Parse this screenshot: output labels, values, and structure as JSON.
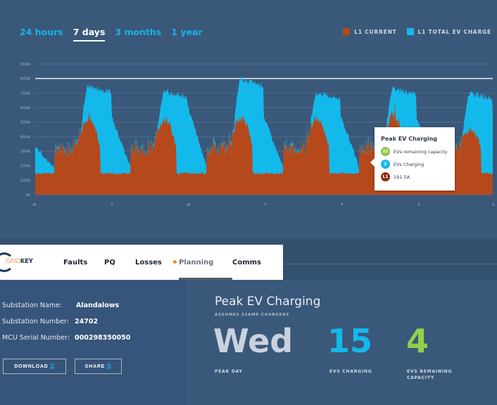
{
  "range_tabs": [
    {
      "label": "24 hours",
      "active": false
    },
    {
      "label": "7 days",
      "active": true
    },
    {
      "label": "3 months",
      "active": false
    },
    {
      "label": "1 year",
      "active": false
    }
  ],
  "legend": [
    {
      "label": "L1 CURRENT",
      "color": "#b5491c"
    },
    {
      "label": "L1 TOTAL EV CHARGE",
      "color": "#14b9ec"
    }
  ],
  "chart_data": {
    "type": "area",
    "title": "",
    "xlabel": "",
    "ylabel": "",
    "x_ticks": [
      "M",
      "T",
      "W",
      "T",
      "F",
      "S",
      "S"
    ],
    "y_ticks": [
      "0A",
      "100A",
      "200A",
      "300A",
      "400A",
      "500A",
      "600A",
      "700A",
      "800A",
      "900A"
    ],
    "ylim": [
      0,
      900
    ],
    "grid": true,
    "threshold_line": 800,
    "legend_position": "top-right",
    "series": [
      {
        "name": "L1 CURRENT",
        "color": "#b5491c",
        "daily_profile_peaks": [
          490,
          490,
          500,
          500,
          510,
          410,
          500
        ],
        "baseline": 140
      },
      {
        "name": "L1 TOTAL EV CHARGE",
        "color": "#14b9ec",
        "daily_profile_peaks": [
          740,
          700,
          790,
          690,
          720,
          690,
          700
        ],
        "baseline": 170
      }
    ]
  },
  "tooltip": {
    "title": "Peak EV Charging",
    "rows": [
      {
        "badge": "22",
        "text": "EVs remaining capacity",
        "color": "#8dc63f"
      },
      {
        "badge": "2",
        "text": "EVs Charging",
        "color": "#14b9ec"
      },
      {
        "badge": "L1",
        "text": "191.5A",
        "color": "#8a2e12"
      }
    ]
  },
  "nav": {
    "brand_part1": "GRID",
    "brand_part2": "KEY",
    "items": [
      {
        "label": "Faults",
        "active": false
      },
      {
        "label": "PQ",
        "active": false
      },
      {
        "label": "Losses",
        "active": false
      },
      {
        "label": "Planning",
        "active": true
      },
      {
        "label": "Comms",
        "active": false
      }
    ]
  },
  "substation": {
    "name_label": "Substation Name:",
    "name_value": "Alandalows",
    "number_label": "Substation Number:",
    "number_value": "24702",
    "mcu_label": "MCU Serial Number:",
    "mcu_value": "000298350050"
  },
  "buttons": {
    "download": "DOWNLOAD",
    "share": "SHARE"
  },
  "peak": {
    "title": "Peak EV Charging",
    "subtitle": "ASSUMES 32AMP CHARGERS",
    "day_value": "Wed",
    "day_label": "PEAK DAY",
    "charging_value": "15",
    "charging_label": "EVS CHARGING",
    "remaining_value": "4",
    "remaining_label_1": "EVS REMAINING",
    "remaining_label_2": "CAPACITY"
  }
}
